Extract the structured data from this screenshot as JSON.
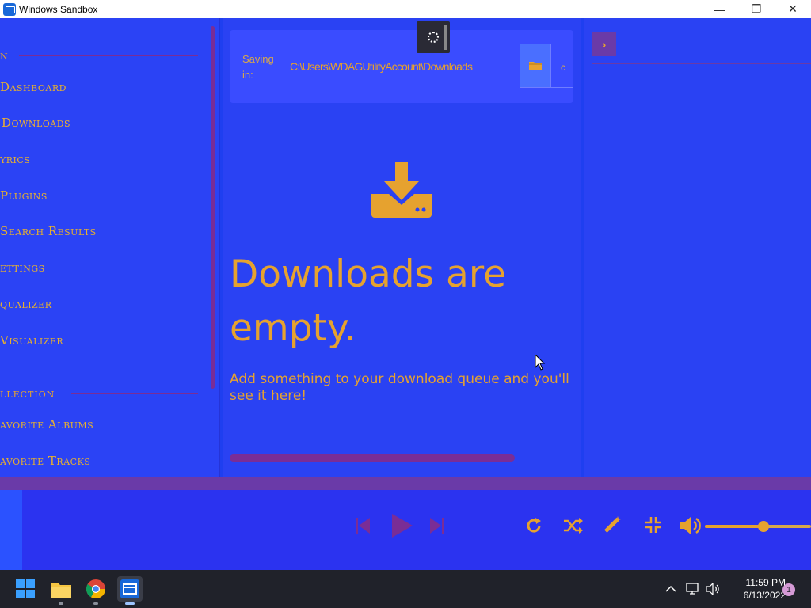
{
  "window": {
    "title": "Windows Sandbox",
    "minimize_glyph": "—",
    "restore_glyph": "❐",
    "close_glyph": "✕"
  },
  "sidebar": {
    "section1_heading": "n",
    "items": [
      {
        "label": "Dashboard"
      },
      {
        "label": "Downloads",
        "active": true
      },
      {
        "label": "yrics"
      },
      {
        "label": "Plugins"
      },
      {
        "label": "Search Results"
      },
      {
        "label": "ettings"
      },
      {
        "label": "qualizer"
      },
      {
        "label": "Visualizer"
      }
    ],
    "section2_heading": "llection",
    "collection_items": [
      {
        "label": "avorite Albums"
      },
      {
        "label": "avorite Tracks"
      }
    ]
  },
  "downloads": {
    "saving_label": "Saving in:",
    "path": "C:\\Users\\WDAGUtilityAccount\\Downloads",
    "extra_char": "c",
    "empty_title": "Downloads are empty.",
    "empty_subtitle": "Add something to your download queue and you'll see it here!"
  },
  "right_panel": {
    "toggle_glyph": "›"
  },
  "player": {
    "volume_fraction": 0.55
  },
  "taskbar": {
    "time": "11:59 PM",
    "date": "6/13/2022",
    "notification_count": "1"
  },
  "colors": {
    "accent": "#e6a22f",
    "background": "#1f3ff0",
    "purple": "#7a2d96",
    "taskbar": "#20222a"
  }
}
